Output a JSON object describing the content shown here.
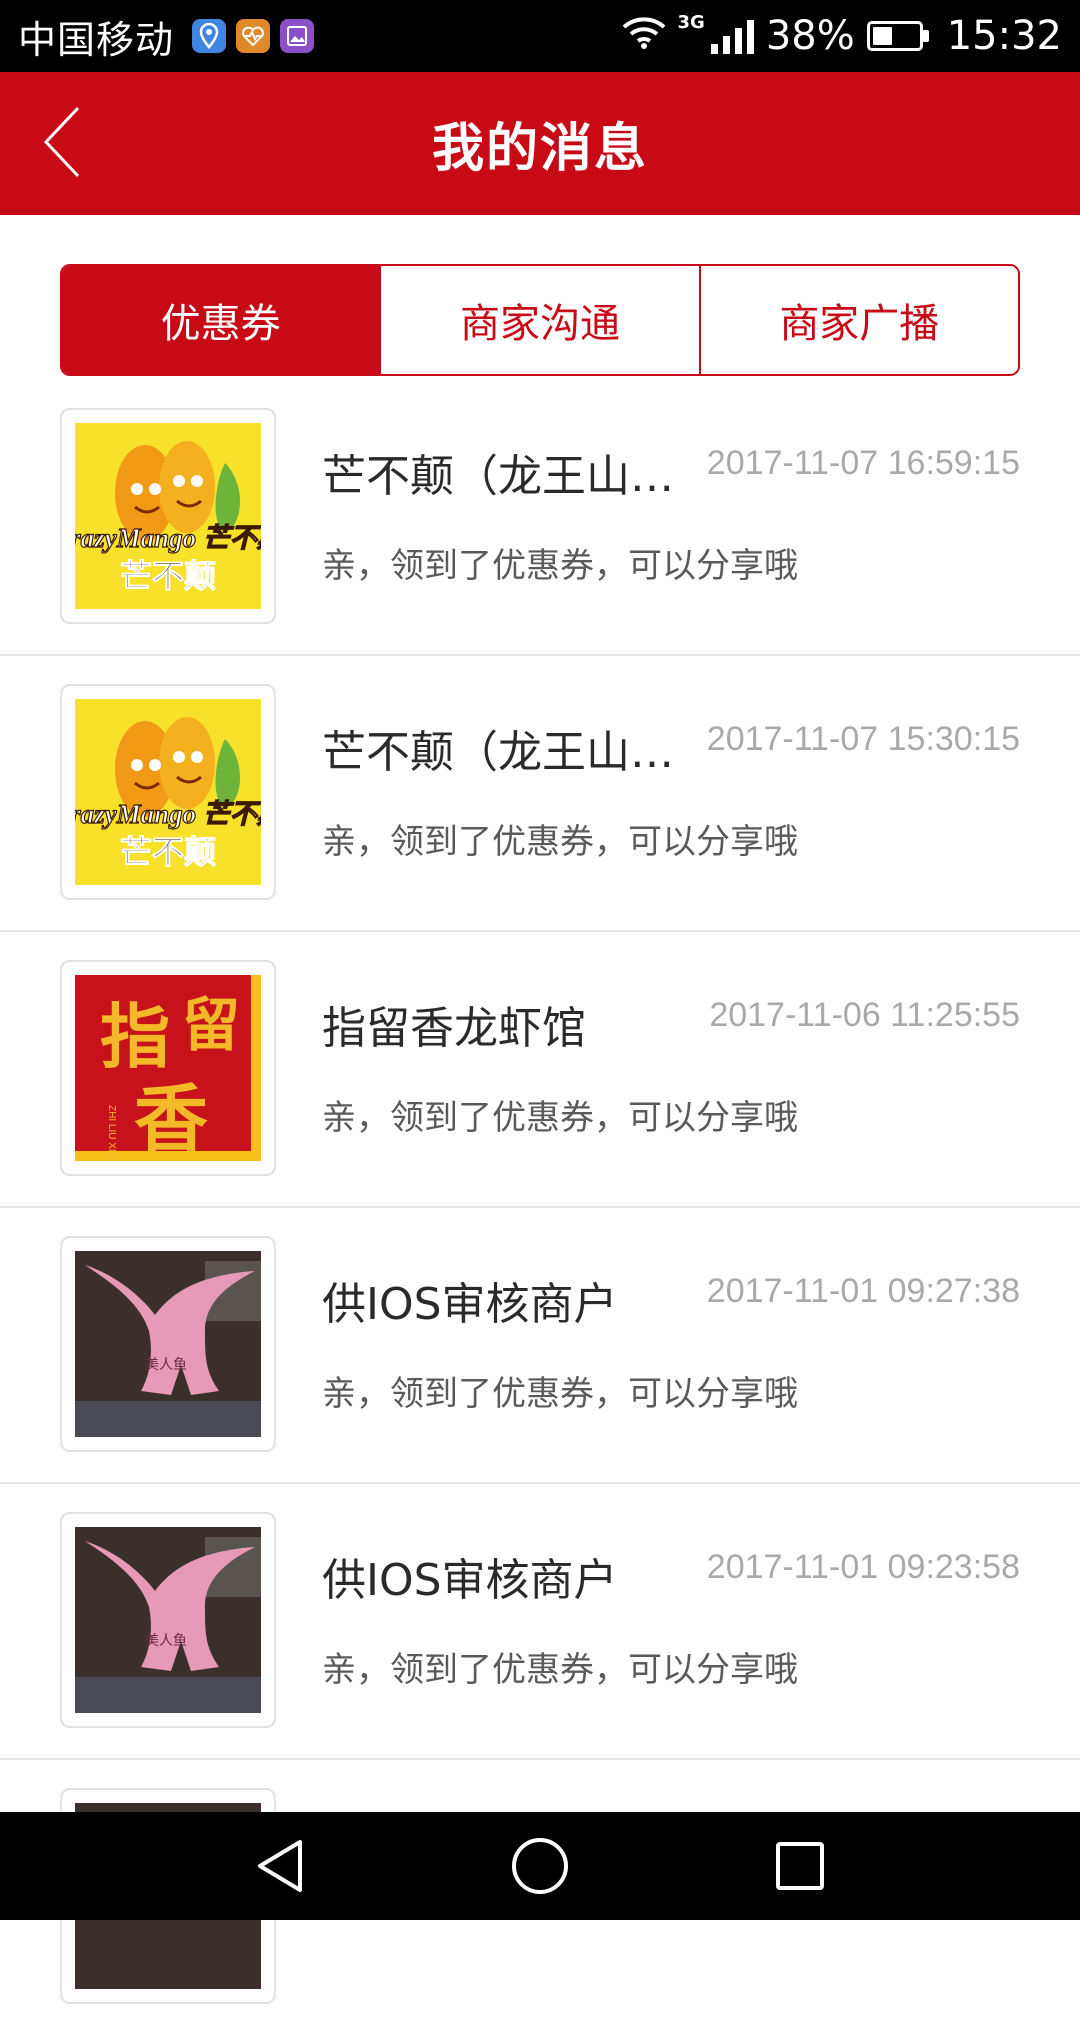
{
  "status_bar": {
    "carrier": "中国移动",
    "network": "3G",
    "battery": "38%",
    "time": "15:32",
    "icons": [
      "location-icon",
      "health-icon",
      "gallery-icon",
      "wifi-icon",
      "signal-icon",
      "battery-icon"
    ]
  },
  "header": {
    "title": "我的消息",
    "back_icon": "chevron-left-icon"
  },
  "tabs": [
    {
      "label": "优惠券",
      "active": true
    },
    {
      "label": "商家沟通",
      "active": false
    },
    {
      "label": "商家广播",
      "active": false
    }
  ],
  "messages": [
    {
      "name": "芒不颠（龙王山店）",
      "time": "2017-11-07 16:59:15",
      "text": "亲，领到了优惠券，可以分享哦",
      "logo": "crazymango-logo",
      "logo_text": "CrazyMango 芒不颠"
    },
    {
      "name": "芒不颠（龙王山店）",
      "time": "2017-11-07 15:30:15",
      "text": "亲，领到了优惠券，可以分享哦",
      "logo": "crazymango-logo",
      "logo_text": "CrazyMango 芒不颠"
    },
    {
      "name": "指留香龙虾馆",
      "time": "2017-11-06 11:25:55",
      "text": "亲，领到了优惠券，可以分享哦",
      "logo": "zhiliuxiang-logo",
      "logo_text": "指留香"
    },
    {
      "name": "供IOS审核商户",
      "time": "2017-11-01 09:27:38",
      "text": "亲，领到了优惠券，可以分享哦",
      "logo": "pink-statue-photo"
    },
    {
      "name": "供IOS审核商户",
      "time": "2017-11-01 09:23:58",
      "text": "亲，领到了优惠券，可以分享哦",
      "logo": "pink-statue-photo"
    }
  ],
  "nav": {
    "icons": [
      "back-triangle-icon",
      "home-circle-icon",
      "recents-square-icon"
    ]
  },
  "colors": {
    "brand_red": "#c80a17",
    "time_gray": "#a9a9a9"
  }
}
